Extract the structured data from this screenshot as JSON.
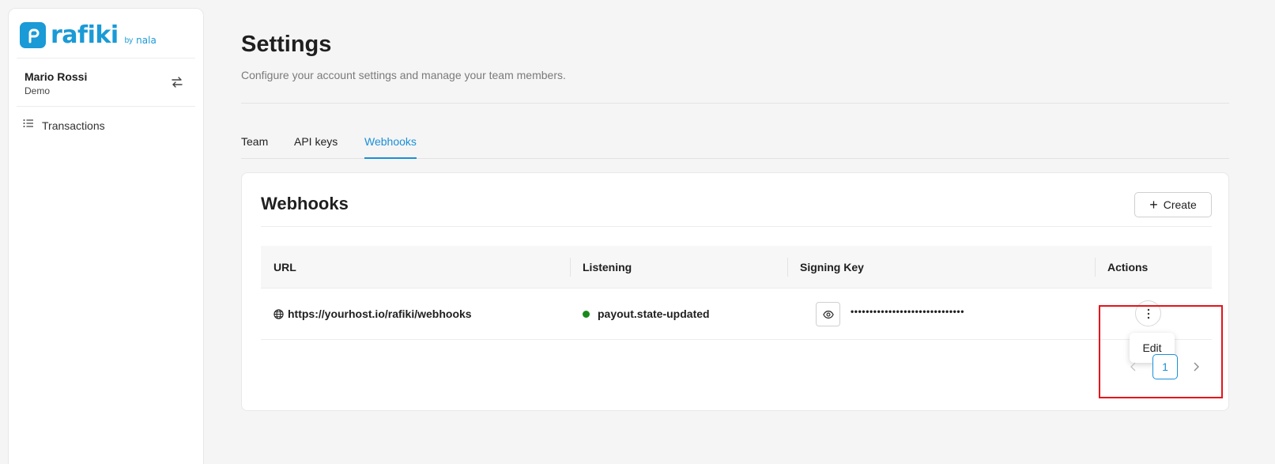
{
  "brand": {
    "name": "rafiki",
    "by": "by",
    "partner": "nala",
    "color": "#1a9ad6"
  },
  "user": {
    "name": "Mario Rossi",
    "org": "Demo",
    "switch_icon": "swap-arrows-icon"
  },
  "sidebar": {
    "items": [
      {
        "label": "Transactions",
        "icon": "list-icon"
      }
    ]
  },
  "page": {
    "title": "Settings",
    "subtitle": "Configure your account settings and manage your team members."
  },
  "tabs": [
    {
      "label": "Team",
      "active": false
    },
    {
      "label": "API keys",
      "active": false
    },
    {
      "label": "Webhooks",
      "active": true
    }
  ],
  "webhooks": {
    "title": "Webhooks",
    "create_label": "Create",
    "columns": [
      "URL",
      "Listening",
      "Signing Key",
      "Actions"
    ],
    "rows": [
      {
        "url": "https://yourhost.io/rafiki/webhooks",
        "url_icon": "globe-icon",
        "listening": "payout.state-updated",
        "status_color": "#198a19",
        "signing_key_masked": "••••••••••••••••••••••••••••••",
        "reveal_icon": "eye-icon",
        "actions_icon": "kebab-menu-icon"
      }
    ],
    "action_menu": {
      "items": [
        "Edit"
      ]
    },
    "pagination": {
      "current": "1"
    }
  },
  "colors": {
    "accent": "#1a8fd8",
    "highlight": "#e5141b"
  }
}
